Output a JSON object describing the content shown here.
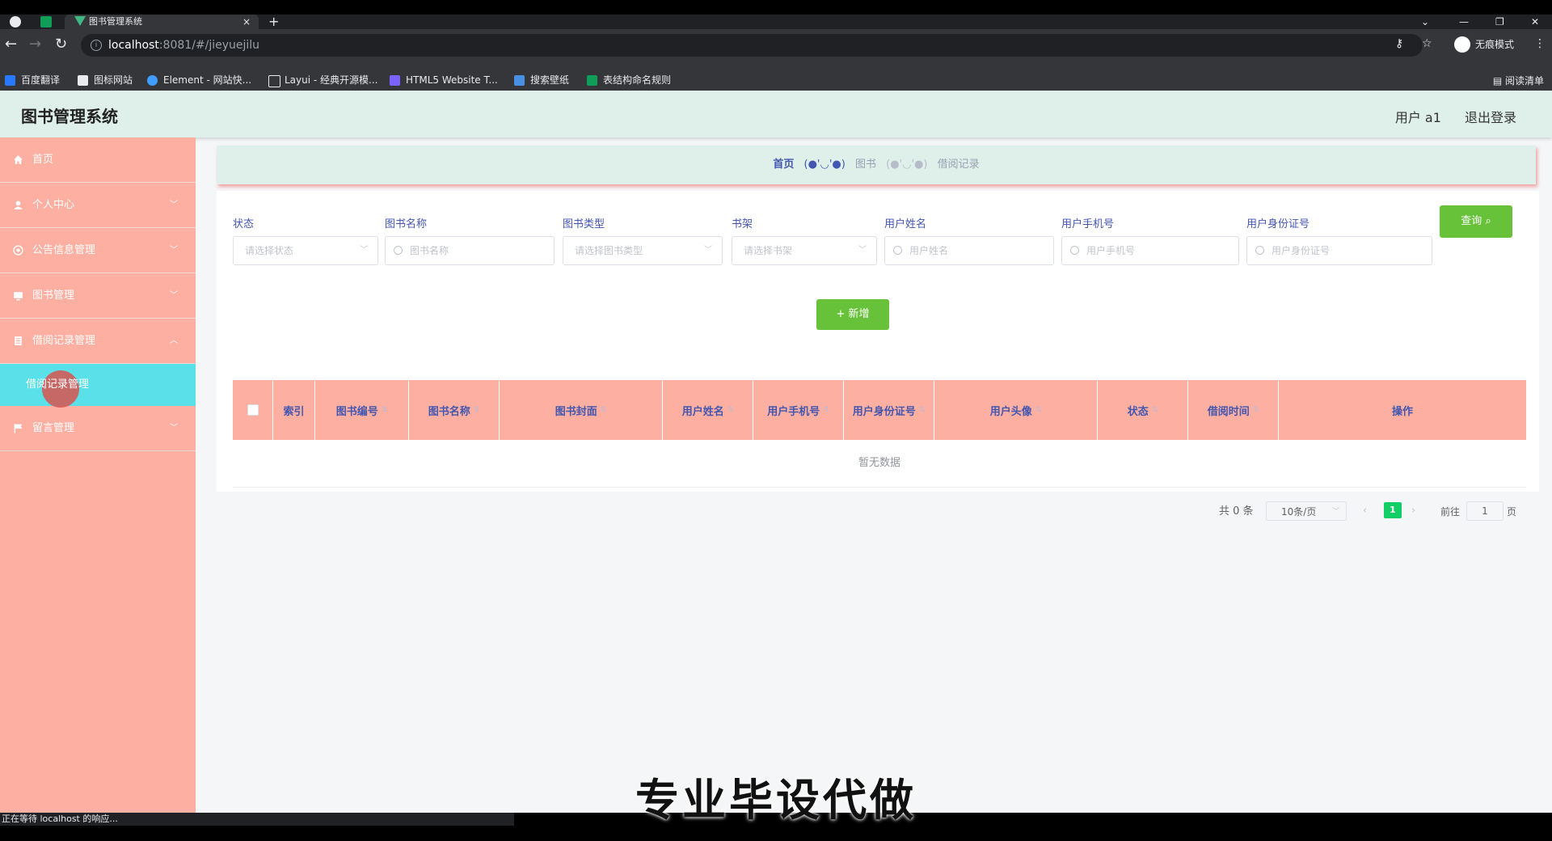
{
  "browser": {
    "tab_title": "图书管理系统",
    "tab_close": "×",
    "new_tab": "+",
    "url_host": "localhost",
    "url_path": ":8081/#/jieyuejilu",
    "incognito_label": "无痕模式",
    "bookmarks": [
      "百度翻译",
      "图标网站",
      "Element - 网站快...",
      "Layui - 经典开源模...",
      "HTML5 Website T...",
      "搜索壁纸",
      "表结构命名规则"
    ],
    "reading_list": "阅读清单",
    "status_text": "正在等待 localhost 的响应..."
  },
  "header": {
    "title": "图书管理系统",
    "user": "用户 a1",
    "logout": "退出登录"
  },
  "sidebar": {
    "items": [
      {
        "label": "首页",
        "icon": "home-icon"
      },
      {
        "label": "个人中心",
        "icon": "user-icon"
      },
      {
        "label": "公告信息管理",
        "icon": "notice-icon"
      },
      {
        "label": "图书管理",
        "icon": "monitor-icon"
      },
      {
        "label": "借阅记录管理",
        "icon": "list-icon"
      },
      {
        "label": "留言管理",
        "icon": "flag-icon"
      }
    ],
    "active_sub": "借阅记录管理"
  },
  "breadcrumb": {
    "home": "首页",
    "sep": "(●'◡'●)",
    "mid": "图书",
    "current": "借阅记录"
  },
  "filters": {
    "status_label": "状态",
    "status_placeholder": "请选择状态",
    "book_name_label": "图书名称",
    "book_name_placeholder": "图书名称",
    "book_type_label": "图书类型",
    "book_type_placeholder": "请选择图书类型",
    "shelf_label": "书架",
    "shelf_placeholder": "请选择书架",
    "user_name_label": "用户姓名",
    "user_name_placeholder": "用户姓名",
    "user_phone_label": "用户手机号",
    "user_phone_placeholder": "用户手机号",
    "user_id_label": "用户身份证号",
    "user_id_placeholder": "用户身份证号",
    "query_button": "查询",
    "add_button": "+ 新增"
  },
  "table": {
    "columns": [
      "索引",
      "图书编号",
      "图书名称",
      "图书封面",
      "用户姓名",
      "用户手机号",
      "用户身份证号",
      "用户头像",
      "状态",
      "借阅时间",
      "操作"
    ],
    "empty_text": "暂无数据"
  },
  "pagination": {
    "total": "共 0 条",
    "page_size": "10条/页",
    "current_page": "1",
    "goto_label": "前往",
    "goto_value": "1",
    "page_suffix": "页"
  },
  "caption": "专业毕设代做",
  "colors": {
    "sidebar": "#fdb0a2",
    "header": "#dff0ea",
    "accent": "#67c23a",
    "active_sub": "#5ae0e8",
    "label": "#4356b0"
  }
}
